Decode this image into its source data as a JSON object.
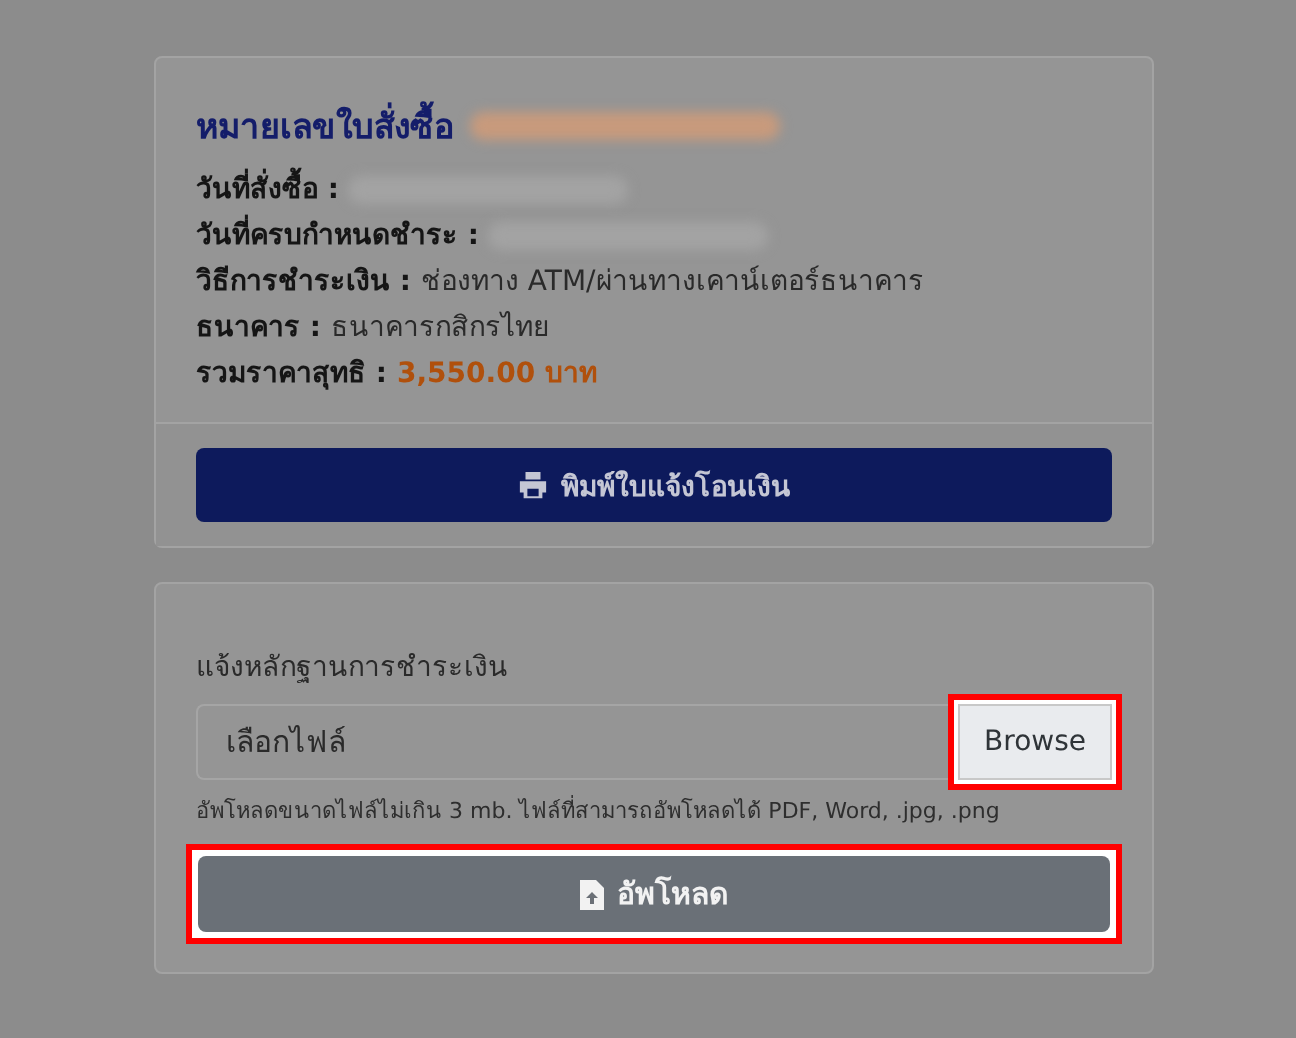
{
  "order": {
    "title": "หมายเลขใบสั่งซื้อ",
    "number_redacted": true,
    "fields": [
      {
        "label": "วันที่สั่งซื้อ :",
        "kind": "redacted"
      },
      {
        "label": "วันที่ครบกำหนดชำระ :",
        "kind": "redacted"
      },
      {
        "label": "วิธีการชำระเงิน :",
        "kind": "text",
        "value": "ช่องทาง ATM/ผ่านทางเคาน์เตอร์ธนาคาร"
      },
      {
        "label": "ธนาคาร :",
        "kind": "text",
        "value": "ธนาคารกสิกรไทย"
      },
      {
        "label": "รวมราคาสุทธิ :",
        "kind": "amount",
        "value": "3,550.00 บาท"
      }
    ],
    "print_button": "พิมพ์ใบแจ้งโอนเงิน"
  },
  "upload": {
    "label": "แจ้งหลักฐานการชำระเงิน",
    "file_field": {
      "placeholder": "เลือกไฟล์"
    },
    "browse_button": {
      "label": "Browse",
      "highlighted": true
    },
    "hint": "อัพโหลดขนาดไฟล์ไม่เกิน 3 mb. ไฟล์ที่สามารถอัพโหลดได้ PDF, Word, .jpg, .png",
    "upload_button": {
      "label": "อัพโหลด",
      "highlighted": true
    }
  }
}
